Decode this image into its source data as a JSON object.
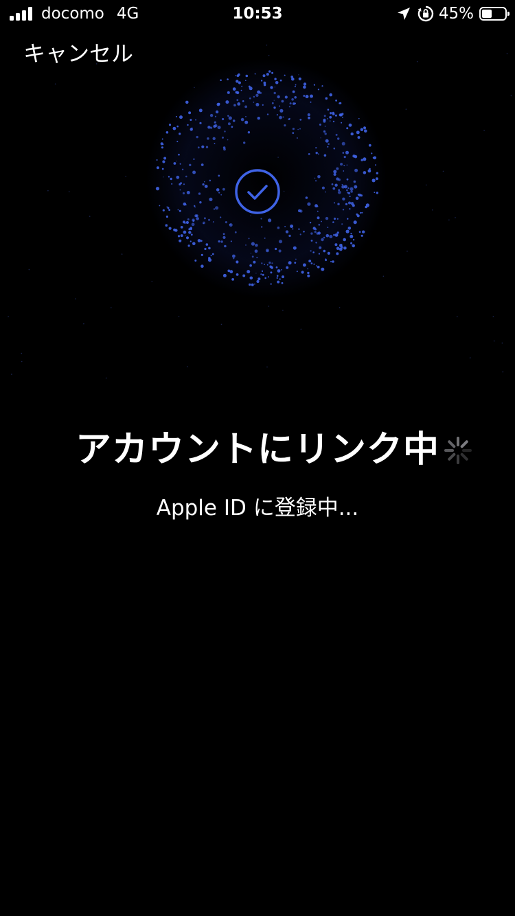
{
  "status_bar": {
    "carrier": "docomo",
    "network": "4G",
    "time": "10:53",
    "battery_percent_text": "45%",
    "battery_level": 0.45,
    "icons": [
      "signal-bars-icon",
      "location-arrow-icon",
      "orientation-lock-icon",
      "battery-icon"
    ]
  },
  "nav": {
    "cancel_label": "キャンセル"
  },
  "main": {
    "title": "アカウントにリンク中",
    "subtitle": "Apple ID に登録中...",
    "status_icon": "checkmark-circle-icon",
    "activity_icon": "activity-spinner-icon"
  },
  "colors": {
    "background": "#000000",
    "accent": "#3f63e6",
    "text": "#ffffff"
  }
}
